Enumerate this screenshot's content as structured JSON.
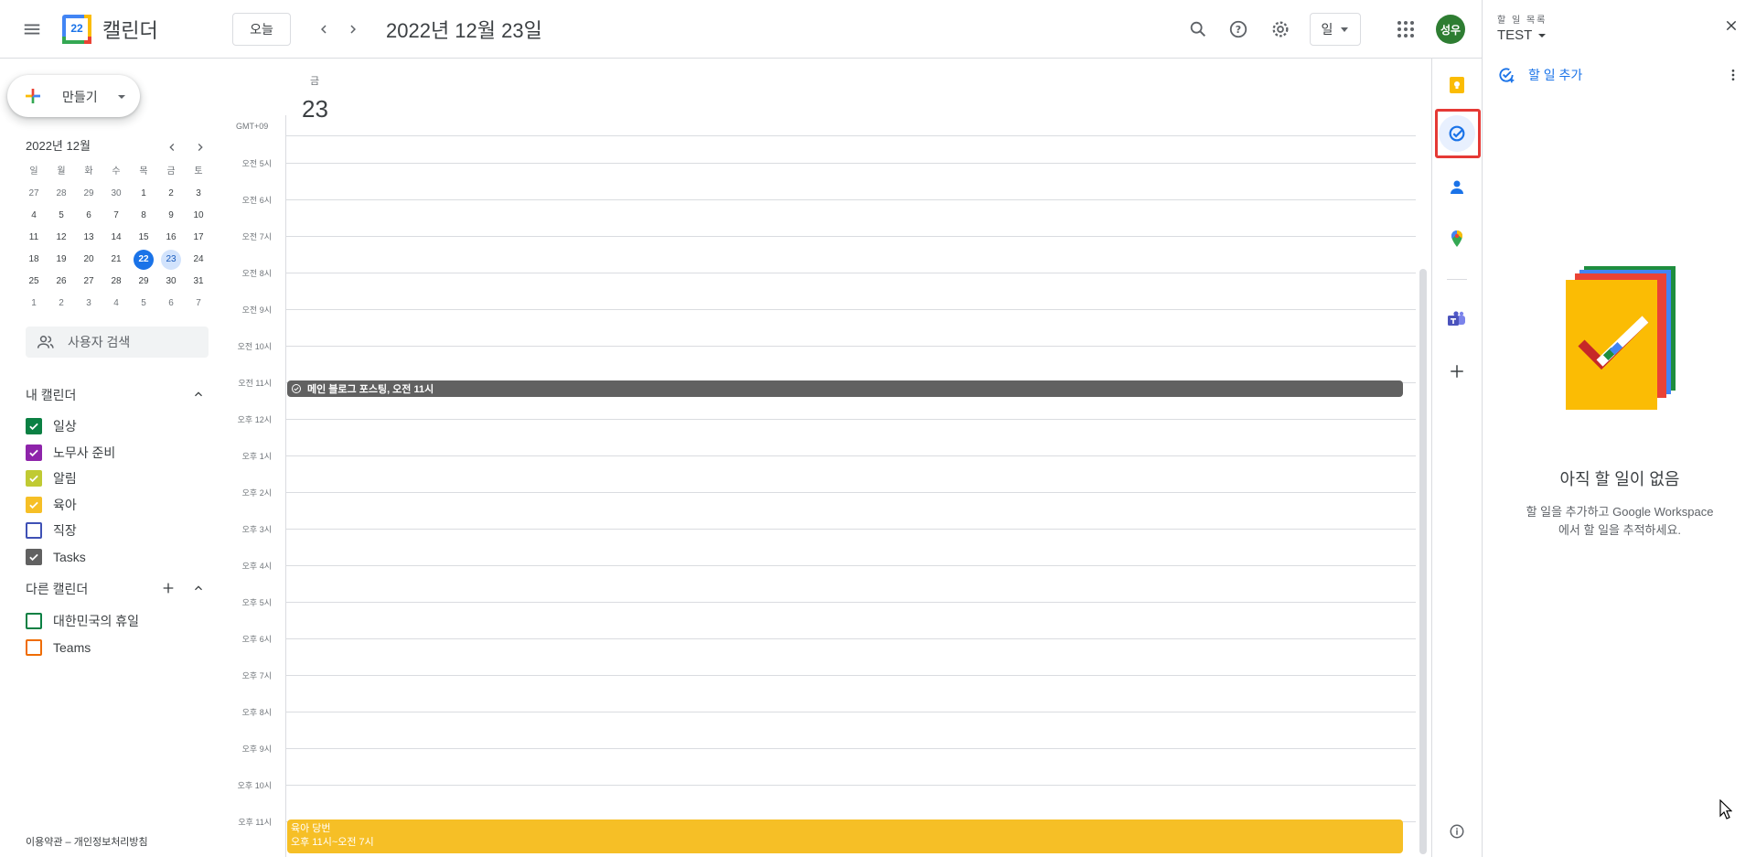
{
  "header": {
    "app_title": "캘린더",
    "logo_day": "22",
    "today_label": "오늘",
    "date_title": "2022년 12월 23일",
    "view_label": "일",
    "avatar_text": "성우"
  },
  "sidebar": {
    "create_label": "만들기",
    "mini_month_title": "2022년 12월",
    "weekdays": [
      "일",
      "월",
      "화",
      "수",
      "목",
      "금",
      "토"
    ],
    "weeks": [
      [
        "27",
        "28",
        "29",
        "30",
        "1",
        "2",
        "3"
      ],
      [
        "4",
        "5",
        "6",
        "7",
        "8",
        "9",
        "10"
      ],
      [
        "11",
        "12",
        "13",
        "14",
        "15",
        "16",
        "17"
      ],
      [
        "18",
        "19",
        "20",
        "21",
        "22",
        "23",
        "24"
      ],
      [
        "25",
        "26",
        "27",
        "28",
        "29",
        "30",
        "31"
      ],
      [
        "1",
        "2",
        "3",
        "4",
        "5",
        "6",
        "7"
      ]
    ],
    "today_date": "22",
    "selected_date": "23",
    "user_search_placeholder": "사용자 검색",
    "my_calendars_title": "내 캘린더",
    "my_calendars": [
      {
        "label": "일상",
        "color": "#0b8043",
        "checked": true
      },
      {
        "label": "노무사 준비",
        "color": "#8e24aa",
        "checked": true
      },
      {
        "label": "알림",
        "color": "#c0ca33",
        "checked": true
      },
      {
        "label": "육아",
        "color": "#f6bf26",
        "checked": true
      },
      {
        "label": "직장",
        "color": "#3f51b5",
        "checked": false
      },
      {
        "label": "Tasks",
        "color": "#616161",
        "checked": true
      }
    ],
    "other_calendars_title": "다른 캘린더",
    "other_calendars": [
      {
        "label": "대한민국의 휴일",
        "color": "#0b8043",
        "checked": false
      },
      {
        "label": "Teams",
        "color": "#ef6c00",
        "checked": false
      }
    ],
    "footer_text": "이용약관 – 개인정보처리방침"
  },
  "day_view": {
    "weekday": "금",
    "day_number": "23",
    "timezone": "GMT+09",
    "hours": [
      "오전 5시",
      "오전 6시",
      "오전 7시",
      "오전 8시",
      "오전 9시",
      "오전 10시",
      "오전 11시",
      "오후 12시",
      "오후 1시",
      "오후 2시",
      "오후 3시",
      "오후 4시",
      "오후 5시",
      "오후 6시",
      "오후 7시",
      "오후 8시",
      "오후 9시",
      "오후 10시",
      "오후 11시"
    ],
    "events": {
      "task_event": "메인 블로그 포스팅, 오전 11시",
      "night_event_title": "육아 당번",
      "night_event_time": "오후 11시~오전 7시",
      "task_color": "#616161",
      "night_color": "#f6bf26"
    }
  },
  "tasks_panel": {
    "subtitle": "할 일 목록",
    "list_name": "TEST",
    "add_task_label": "할 일 추가",
    "empty_title": "아직 할 일이 없음",
    "empty_description": "할 일을 추가하고 Google Workspace에서 할 일을 추적하세요."
  }
}
